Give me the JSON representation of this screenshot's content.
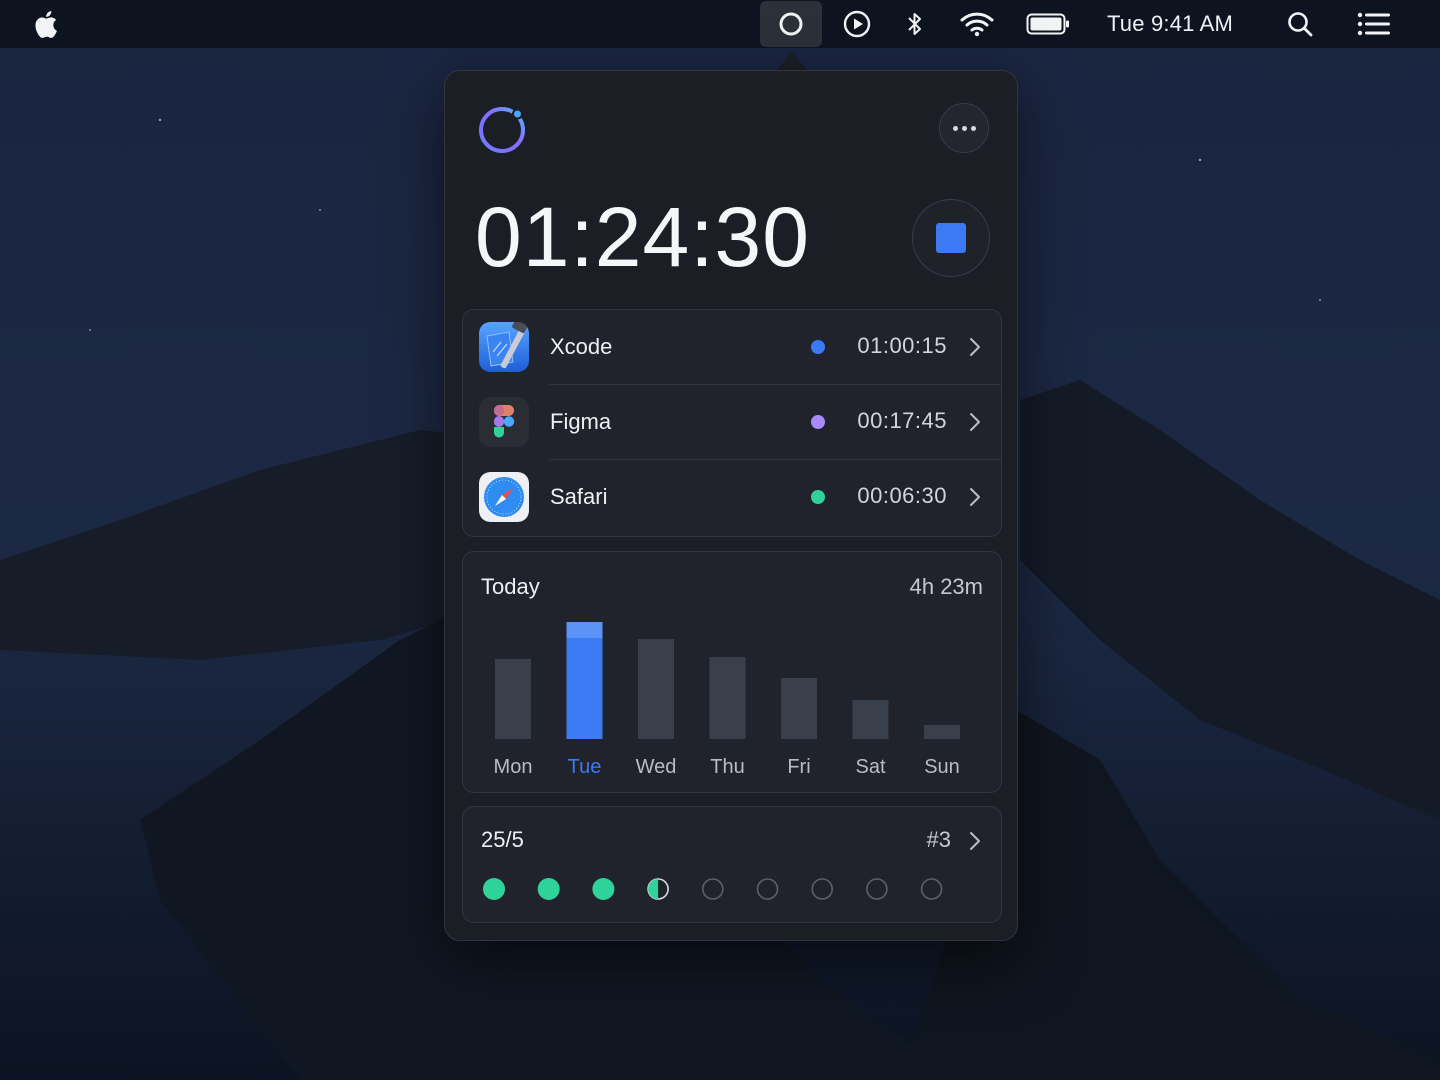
{
  "menubar": {
    "clock": "Tue 9:41 AM",
    "icons": [
      "apple-icon",
      "timer-app-icon",
      "play-circle-icon",
      "bluetooth-icon",
      "wifi-icon",
      "battery-icon",
      "search-icon",
      "list-icon"
    ]
  },
  "popover": {
    "timer": "01:24:30",
    "apps": [
      {
        "name": "Xcode",
        "time": "01:00:15",
        "color": "#3b7af2",
        "icon": "xcode-icon"
      },
      {
        "name": "Figma",
        "time": "00:17:45",
        "color": "#a78bfa",
        "icon": "figma-icon"
      },
      {
        "name": "Safari",
        "time": "00:06:30",
        "color": "#2fd39a",
        "icon": "safari-icon"
      }
    ],
    "today": {
      "label": "Today",
      "total": "4h 23m"
    },
    "pomodoro": {
      "label": "25/5",
      "session": "#3",
      "completed": 3,
      "half": 1,
      "total": 9
    }
  },
  "colors": {
    "accent": "#3b7af2",
    "bar_inactive": "#3a3f4c",
    "pomodoro": "#2fd39a"
  },
  "chart_data": {
    "type": "bar",
    "categories": [
      "Mon",
      "Tue",
      "Wed",
      "Thu",
      "Fri",
      "Sat",
      "Sun"
    ],
    "values": [
      80,
      117,
      100,
      82,
      61,
      39,
      14
    ],
    "highlight": "Tue"
  }
}
